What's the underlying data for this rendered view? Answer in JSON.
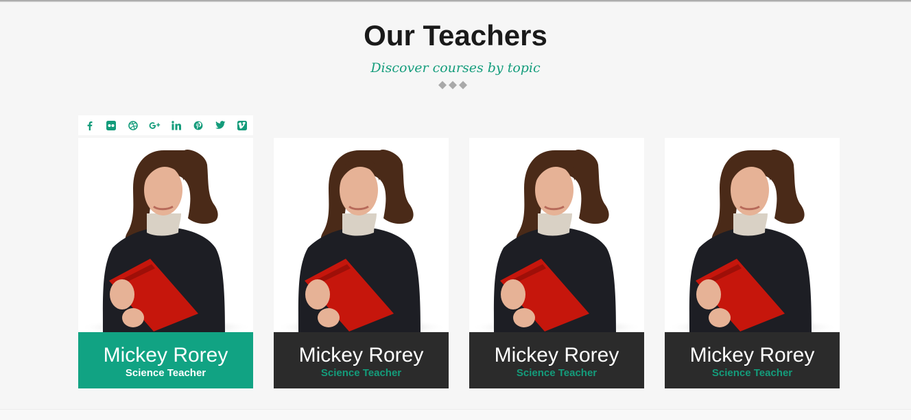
{
  "section": {
    "title": "Our Teachers",
    "subtitle": "Discover courses by topic"
  },
  "social_icons": [
    "facebook-icon",
    "flickr-icon",
    "dribbble-icon",
    "google-plus-icon",
    "linkedin-icon",
    "pinterest-icon",
    "twitter-icon",
    "vimeo-icon"
  ],
  "teachers": [
    {
      "name": "Mickey Rorey",
      "role": "Science Teacher",
      "highlighted": true
    },
    {
      "name": "Mickey Rorey",
      "role": "Science Teacher",
      "highlighted": false
    },
    {
      "name": "Mickey Rorey",
      "role": "Science Teacher",
      "highlighted": false
    },
    {
      "name": "Mickey Rorey",
      "role": "Science Teacher",
      "highlighted": false
    }
  ],
  "colors": {
    "accent": "#11a383",
    "caption_dark": "#2b2b2b",
    "background": "#f6f6f6"
  }
}
